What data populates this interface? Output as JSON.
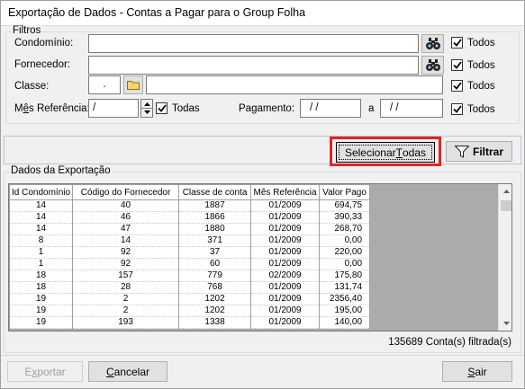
{
  "window": {
    "title": "Exportação de Dados - Contas a Pagar para o Group Folha"
  },
  "filters": {
    "group_title": "Filtros",
    "condominio": {
      "label": "Condomínio:",
      "value": "",
      "todos_label": "Todos"
    },
    "fornecedor": {
      "label": "Fornecedor:",
      "value": "",
      "todos_label": "Todos"
    },
    "classe": {
      "label": "Classe:",
      "code_value": ".",
      "desc_value": "",
      "todos_label": "Todos"
    },
    "mes_referencia": {
      "label_prefix": "M",
      "label_underlined": "ê",
      "label_suffix": "s Referência:",
      "value": " /",
      "todos_label": "Todas"
    },
    "pagamento": {
      "label": "Pagamento:",
      "from_value": "/ /",
      "to_label": "a",
      "to_value": "/ /",
      "todos_label": "Todos"
    }
  },
  "actions": {
    "select_all_prefix": "Selecionar ",
    "select_all_underlined": "T",
    "select_all_suffix": "odas",
    "filter_label": "Filtrar"
  },
  "export_data": {
    "group_title": "Dados da Exportação",
    "columns": [
      "Id Condomínio",
      "Código do Fornecedor",
      "Classe de conta",
      "Mês Referência",
      "Valor Pago"
    ],
    "rows": [
      [
        "14",
        "40",
        "1887",
        "01/2009",
        "694,75"
      ],
      [
        "14",
        "46",
        "1866",
        "01/2009",
        "390,33"
      ],
      [
        "14",
        "47",
        "1880",
        "01/2009",
        "268,70"
      ],
      [
        "8",
        "14",
        "371",
        "01/2009",
        "0,00"
      ],
      [
        "1",
        "92",
        "37",
        "01/2009",
        "220,00"
      ],
      [
        "1",
        "92",
        "60",
        "01/2009",
        "0,00"
      ],
      [
        "18",
        "157",
        "779",
        "02/2009",
        "175,80"
      ],
      [
        "18",
        "28",
        "768",
        "01/2009",
        "131,74"
      ],
      [
        "19",
        "2",
        "1202",
        "01/2009",
        "2356,40"
      ],
      [
        "19",
        "2",
        "1202",
        "01/2009",
        "195,00"
      ],
      [
        "19",
        "193",
        "1338",
        "01/2009",
        "140,00"
      ]
    ],
    "status_text": "135689 Conta(s) filtrada(s)"
  },
  "footer": {
    "export_prefix": "E",
    "export_underlined": "x",
    "export_suffix": "portar",
    "cancel_underlined": "C",
    "cancel_suffix": "ancelar",
    "exit_underlined": "S",
    "exit_suffix": "air"
  },
  "icons": {
    "search": "binoculars-icon",
    "folder": "folder-icon",
    "filter": "funnel-icon",
    "check": "checkmark-icon"
  },
  "colors": {
    "highlight": "#e32424",
    "window_bg": "#f0f0f0",
    "grid_empty_bg": "#ababab",
    "folder": "#f5d76e"
  }
}
